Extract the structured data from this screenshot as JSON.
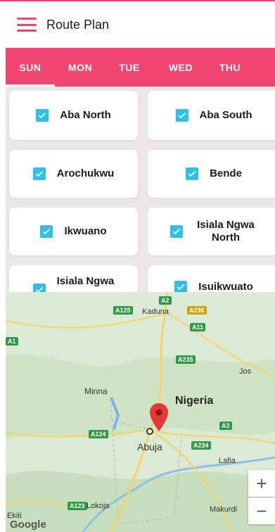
{
  "header": {
    "title": "Route Plan"
  },
  "tabs": [
    {
      "label": "SUN",
      "active": true
    },
    {
      "label": "MON",
      "active": false
    },
    {
      "label": "TUE",
      "active": false
    },
    {
      "label": "WED",
      "active": false
    },
    {
      "label": "THU",
      "active": false
    }
  ],
  "areas": [
    {
      "label": "Aba North",
      "checked": true
    },
    {
      "label": "Aba South",
      "checked": true
    },
    {
      "label": "Arochukwu",
      "checked": true
    },
    {
      "label": "Bende",
      "checked": true
    },
    {
      "label": "Ikwuano",
      "checked": true
    },
    {
      "label": "Isiala Ngwa North",
      "checked": true
    },
    {
      "label": "Isiala Ngwa",
      "checked": true
    },
    {
      "label": "Isuikwuato",
      "checked": true
    }
  ],
  "map": {
    "country_label": "Nigeria",
    "cities": [
      "Kaduna",
      "Minna",
      "Abuja",
      "Lafia",
      "Jos",
      "Lokoja",
      "Makurdi",
      "Ekiti"
    ],
    "roads": [
      "A236",
      "A2",
      "A125",
      "A11",
      "A235",
      "A124",
      "A3",
      "A234",
      "A123",
      "A1"
    ],
    "zoom_in": "+",
    "zoom_out": "−",
    "attribution": "Google"
  },
  "colors": {
    "accent": "#f0456f",
    "checkbox": "#2ec0e6",
    "background": "#ece6e6"
  }
}
